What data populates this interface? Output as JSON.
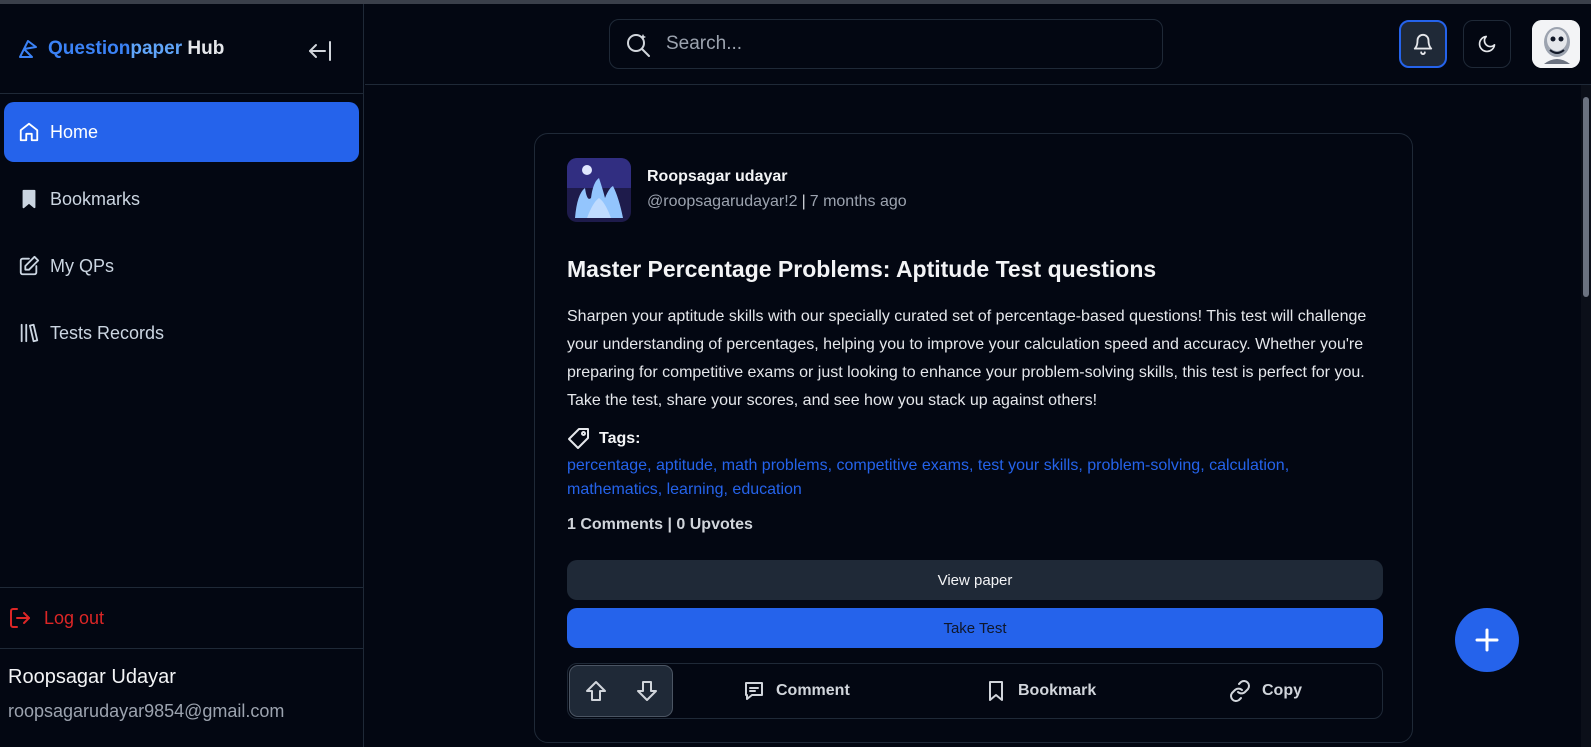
{
  "brand": {
    "part1": "Question",
    "part2": "paper",
    "part3": " Hub"
  },
  "sidebar": {
    "items": [
      {
        "label": "Home",
        "icon": "home-icon",
        "active": true
      },
      {
        "label": "Bookmarks",
        "icon": "bookmark-icon"
      },
      {
        "label": "My QPs",
        "icon": "edit-icon"
      },
      {
        "label": "Tests Records",
        "icon": "library-icon"
      }
    ],
    "logout_label": "Log out",
    "user": {
      "name": "Roopsagar Udayar",
      "email": "roopsagarudayar9854@gmail.com"
    }
  },
  "header": {
    "search_placeholder": "Search..."
  },
  "post": {
    "author_name": "Roopsagar udayar",
    "author_handle": "@roopsagarudayar!2",
    "time_ago": "7 months ago",
    "title": "Master Percentage Problems: Aptitude Test questions",
    "description": "Sharpen your aptitude skills with our specially curated set of percentage-based questions! This test will challenge your understanding of percentages, helping you to improve your calculation speed and accuracy. Whether you're preparing for competitive exams or just looking to enhance your problem-solving skills, this test is perfect for you. Take the test, share your scores, and see how you stack up against others!",
    "tags_label": "Tags:",
    "tags": [
      "percentage",
      "aptitude",
      "math problems",
      "competitive exams",
      "test your skills",
      "problem-solving",
      "calculation",
      "mathematics",
      "learning",
      "education"
    ],
    "comments": "1 Comments",
    "upvotes": "0 Upvotes",
    "view_paper_label": "View paper",
    "take_test_label": "Take Test",
    "comment_label": "Comment",
    "bookmark_label": "Bookmark",
    "copy_label": "Copy"
  },
  "colors": {
    "accent": "#2563eb",
    "danger": "#dc2626",
    "background": "#030712"
  }
}
